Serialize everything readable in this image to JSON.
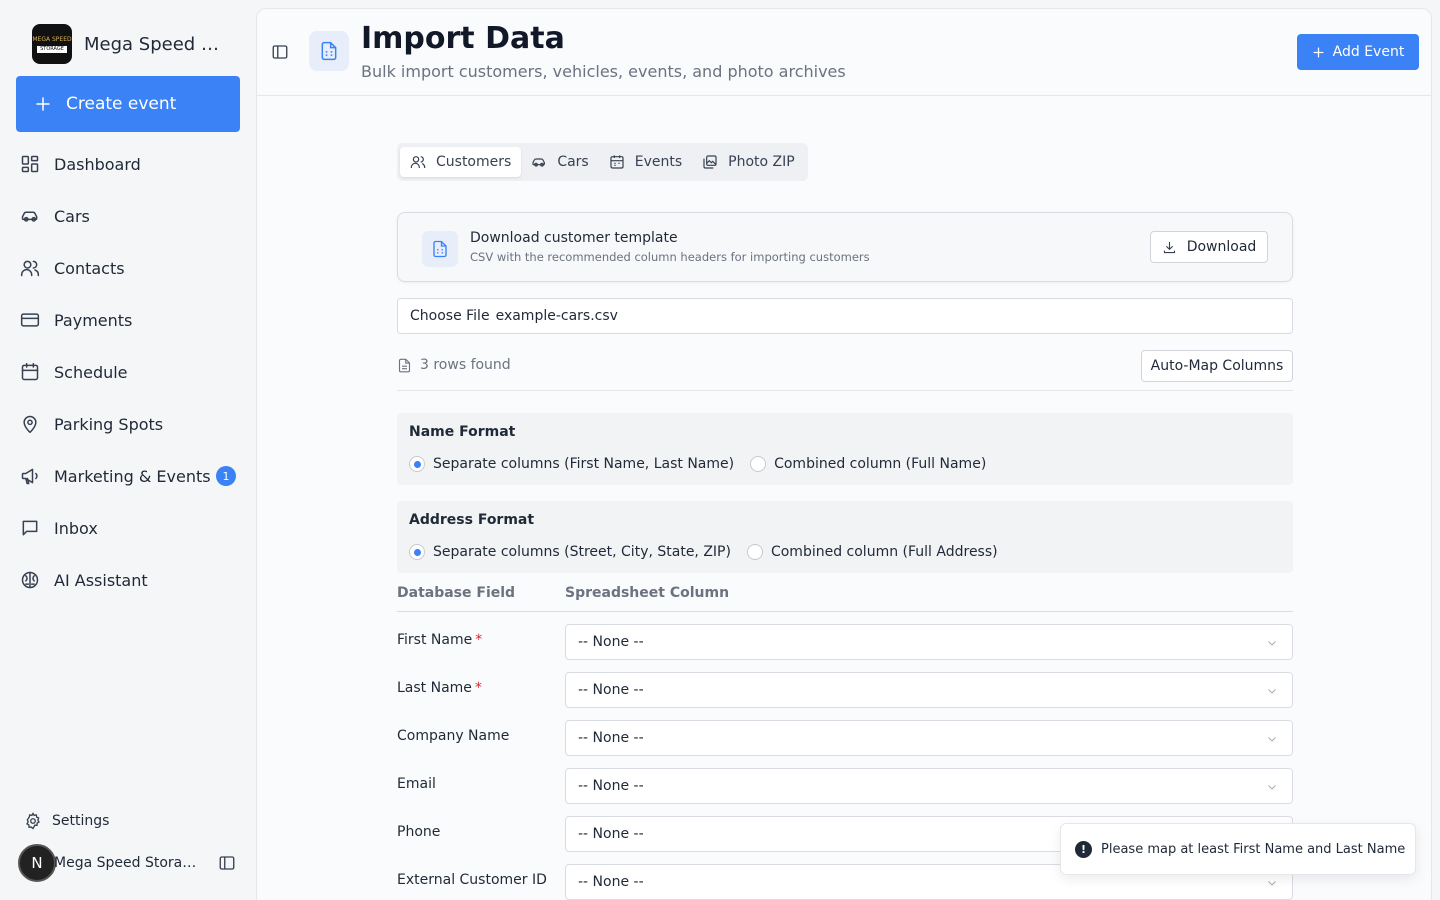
{
  "sidebar": {
    "brand_name": "Mega Speed Storage",
    "logo_text_top": "MEGA SPEED",
    "logo_text_bottom": "STORAGE",
    "create_label": "Create event",
    "items": [
      {
        "label": "Dashboard",
        "icon": "dashboard-icon"
      },
      {
        "label": "Cars",
        "icon": "car-icon"
      },
      {
        "label": "Contacts",
        "icon": "contacts-icon"
      },
      {
        "label": "Payments",
        "icon": "credit-card-icon"
      },
      {
        "label": "Schedule",
        "icon": "calendar-icon"
      },
      {
        "label": "Parking Spots",
        "icon": "map-pin-icon"
      },
      {
        "label": "Marketing & Events",
        "icon": "megaphone-icon",
        "badge": "1"
      },
      {
        "label": "Inbox",
        "icon": "message-square-icon"
      },
      {
        "label": "AI Assistant",
        "icon": "ai-brain-icon"
      }
    ],
    "settings_label": "Settings",
    "user_initial": "N",
    "user_name": "Mega Speed Storage"
  },
  "header": {
    "title": "Import Data",
    "subtitle": "Bulk import customers, vehicles, events, and photo archives",
    "add_event_label": "Add Event"
  },
  "tabs": [
    {
      "label": "Customers",
      "active": true
    },
    {
      "label": "Cars",
      "active": false
    },
    {
      "label": "Events",
      "active": false
    },
    {
      "label": "Photo ZIP",
      "active": false
    }
  ],
  "template_card": {
    "title": "Download customer template",
    "subtitle": "CSV with the recommended column headers for importing customers",
    "download_label": "Download"
  },
  "file_input": {
    "button_label": "Choose File",
    "file_name": "example-cars.csv"
  },
  "rows_found": "3 rows found",
  "automap_label": "Auto-Map Columns",
  "name_format": {
    "title": "Name Format",
    "options": [
      "Separate columns (First Name, Last Name)",
      "Combined column (Full Name)"
    ],
    "selected": 0
  },
  "address_format": {
    "title": "Address Format",
    "options": [
      "Separate columns (Street, City, State, ZIP)",
      "Combined column (Full Address)"
    ],
    "selected": 0
  },
  "mapping": {
    "col_db": "Database Field",
    "col_sheet": "Spreadsheet Column",
    "rows": [
      {
        "field": "First Name",
        "required": "*",
        "value": "-- None --"
      },
      {
        "field": "Last Name",
        "required": "*",
        "value": "-- None --"
      },
      {
        "field": "Company Name",
        "value": "-- None --"
      },
      {
        "field": "Email",
        "value": "-- None --"
      },
      {
        "field": "Phone",
        "value": "-- None --"
      },
      {
        "field": "External Customer ID",
        "value": "-- None --"
      }
    ]
  },
  "toast": {
    "message": "Please map at least First Name and Last Name"
  },
  "colors": {
    "accent": "#3b82f6",
    "required": "#dc2626"
  }
}
